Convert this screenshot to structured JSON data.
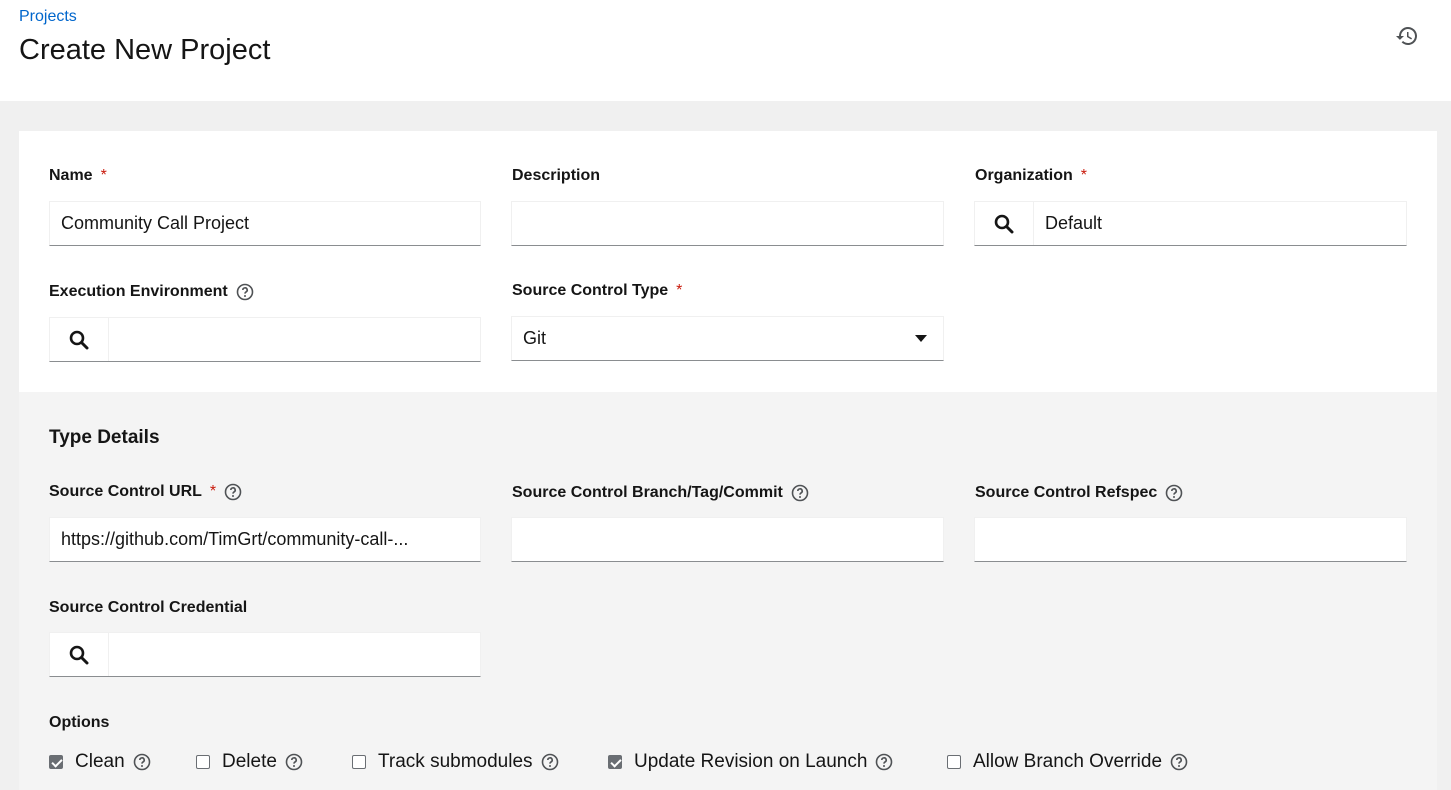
{
  "header": {
    "breadcrumb": "Projects",
    "title": "Create New Project",
    "history_icon": "history-icon"
  },
  "form": {
    "name": {
      "label": "Name",
      "required": "*",
      "value": "Community Call Project"
    },
    "description": {
      "label": "Description",
      "value": ""
    },
    "organization": {
      "label": "Organization",
      "required": "*",
      "value": "Default"
    },
    "execution_environment": {
      "label": "Execution Environment",
      "value": ""
    },
    "source_control_type": {
      "label": "Source Control Type",
      "required": "*",
      "value": "Git"
    }
  },
  "type_details": {
    "title": "Type Details",
    "url": {
      "label": "Source Control URL",
      "required": "*",
      "value": "https://github.com/TimGrt/community-call-..."
    },
    "branch": {
      "label": "Source Control Branch/Tag/Commit",
      "value": ""
    },
    "refspec": {
      "label": "Source Control Refspec",
      "value": ""
    },
    "credential": {
      "label": "Source Control Credential",
      "value": ""
    },
    "options_label": "Options",
    "options": [
      {
        "label": "Clean",
        "checked": true
      },
      {
        "label": "Delete",
        "checked": false
      },
      {
        "label": "Track submodules",
        "checked": false
      },
      {
        "label": "Update Revision on Launch",
        "checked": true
      },
      {
        "label": "Allow Branch Override",
        "checked": false
      }
    ]
  },
  "colors": {
    "link": "#0066cc",
    "required": "#c9190b",
    "border": "#8a8d90",
    "section_bg": "#f4f4f4"
  }
}
